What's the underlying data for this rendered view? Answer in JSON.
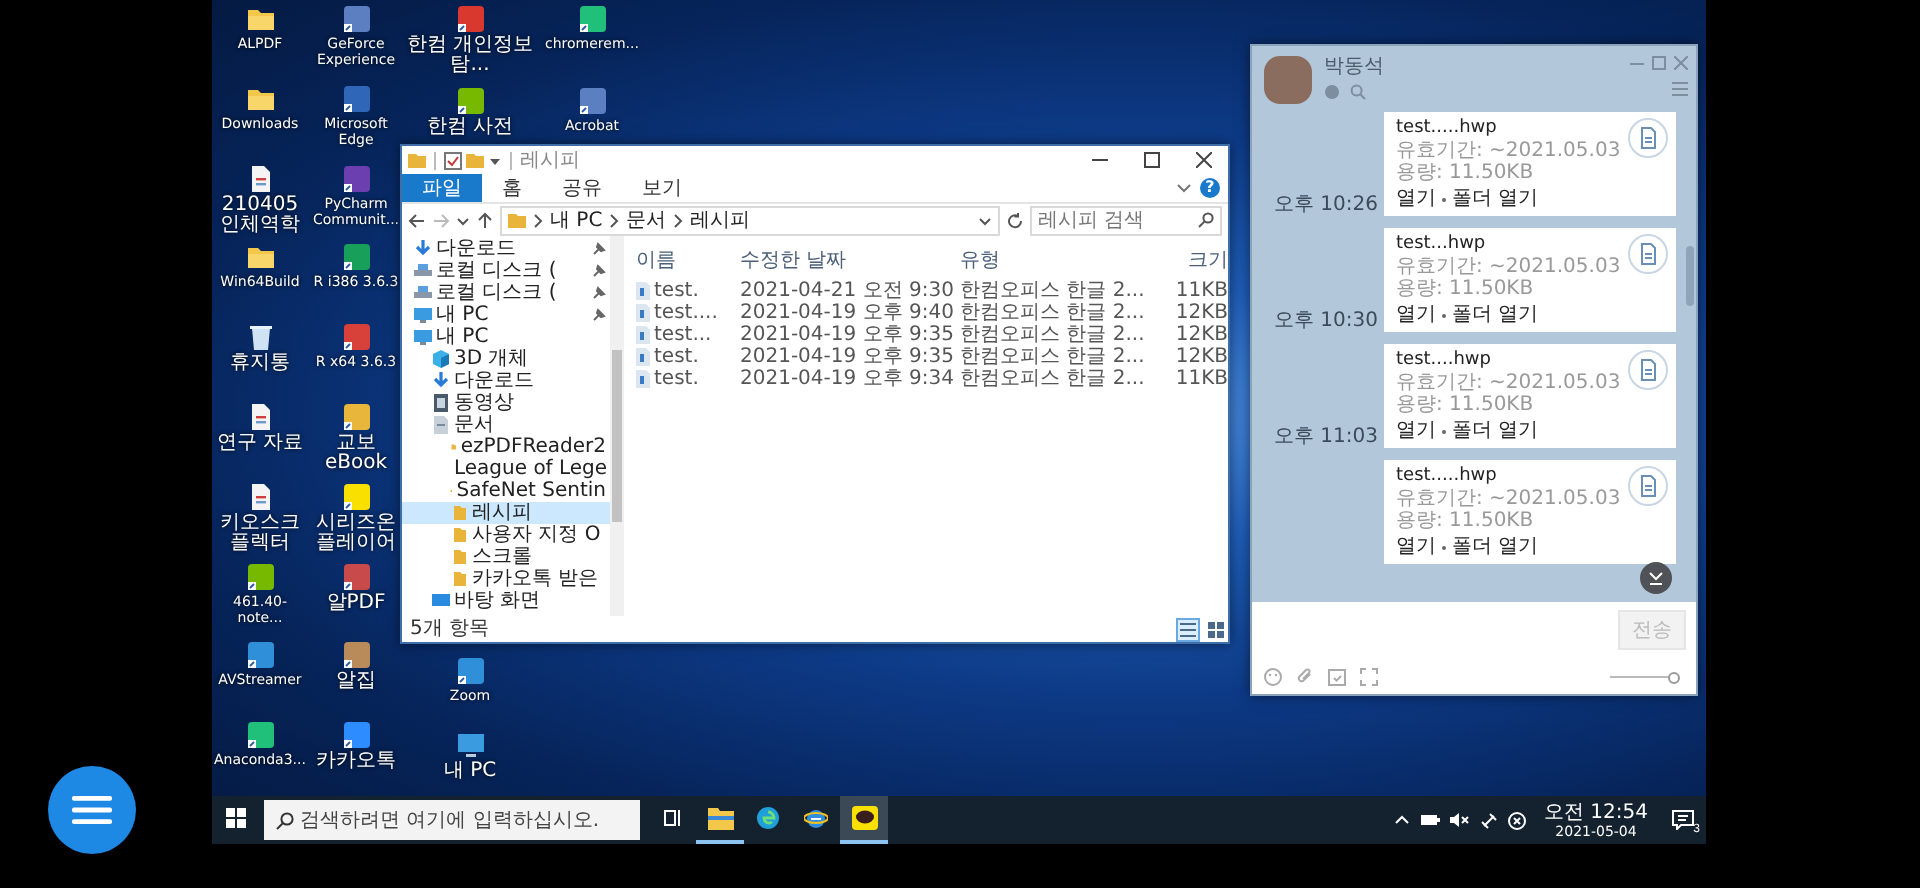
{
  "desktop": {
    "columns": [
      {
        "top": [
          {
            "label": "ALPDF",
            "kind": "folder"
          },
          {
            "label": "Downloads",
            "kind": "folder"
          },
          {
            "label": "210405 인체역학",
            "kind": "file"
          },
          {
            "label": "Win64Build",
            "kind": "folder"
          },
          {
            "label": "휴지통",
            "kind": "recycle"
          },
          {
            "label": "연구 자료",
            "kind": "file"
          },
          {
            "label": "키오스크 플렉터",
            "kind": "file"
          },
          {
            "label": "461.40-note...",
            "kind": "app"
          },
          {
            "label": "AVStreamer",
            "kind": "app"
          },
          {
            "label": "Anaconda3...",
            "kind": "app"
          }
        ]
      },
      {
        "top": [
          {
            "label": "GeForce Experience",
            "kind": "app"
          },
          {
            "label": "Microsoft Edge",
            "kind": "app"
          },
          {
            "label": "PyCharm Communit...",
            "kind": "app"
          },
          {
            "label": "R i386 3.6.3",
            "kind": "app"
          },
          {
            "label": "R x64 3.6.3",
            "kind": "app"
          },
          {
            "label": "교보eBook",
            "kind": "app"
          },
          {
            "label": "시리즈온 플레이어",
            "kind": "app"
          },
          {
            "label": "알PDF",
            "kind": "app"
          },
          {
            "label": "알집",
            "kind": "app"
          },
          {
            "label": "카카오톡",
            "kind": "app"
          }
        ]
      },
      {
        "top": [
          {
            "label": "한컴 개인정보탐...",
            "kind": "app"
          },
          {
            "label": "한컴 사전",
            "kind": "app"
          }
        ],
        "bottom": [
          {
            "label": "Zoom",
            "kind": "app"
          },
          {
            "label": "내 PC",
            "kind": "pc"
          }
        ]
      },
      {
        "top": [
          {
            "label": "chromerem...",
            "kind": "app"
          },
          {
            "label": "Acrobat",
            "kind": "app"
          }
        ]
      }
    ]
  },
  "explorer": {
    "title": "레시피",
    "ribbon_tabs": [
      {
        "label": "파일",
        "selected": true
      },
      {
        "label": "홈",
        "selected": false
      },
      {
        "label": "공유",
        "selected": false
      },
      {
        "label": "보기",
        "selected": false
      }
    ],
    "help": "?",
    "path": [
      "내 PC",
      "문서",
      "레시피"
    ],
    "search": {
      "placeholder": "레시피 검색"
    },
    "nav": [
      {
        "label": "다운로드",
        "kind": "download",
        "pinned": true,
        "selected": false
      },
      {
        "label": "로컬 디스크 (",
        "kind": "drive",
        "pinned": true,
        "selected": false
      },
      {
        "label": "로컬 디스크 (",
        "kind": "drive",
        "pinned": true,
        "selected": false
      },
      {
        "label": "내 PC",
        "kind": "pc",
        "pinned": true,
        "selected": false
      },
      {
        "label": "내 PC",
        "kind": "pc",
        "pinned": false,
        "selected": false,
        "children": [
          {
            "label": "3D 개체",
            "kind": "cube",
            "pinned": false,
            "selected": false
          },
          {
            "label": "다운로드",
            "kind": "download",
            "pinned": false,
            "selected": false
          },
          {
            "label": "동영상",
            "kind": "video",
            "pinned": false,
            "selected": false
          },
          {
            "label": "문서",
            "kind": "document",
            "pinned": false,
            "selected": false,
            "children": [
              {
                "label": "ezPDFReader2",
                "kind": "folder",
                "pinned": false,
                "selected": false
              },
              {
                "label": "League of Lege",
                "kind": "folder",
                "pinned": false,
                "selected": false
              },
              {
                "label": "SafeNet Sentin",
                "kind": "folder",
                "pinned": false,
                "selected": false
              },
              {
                "label": "레시피",
                "kind": "folder",
                "pinned": false,
                "selected": true
              },
              {
                "label": "사용자 지정 O",
                "kind": "folder",
                "pinned": false,
                "selected": false
              },
              {
                "label": "스크롤",
                "kind": "folder",
                "pinned": false,
                "selected": false
              },
              {
                "label": "카카오톡 받은",
                "kind": "folder",
                "pinned": false,
                "selected": false
              }
            ]
          },
          {
            "label": "바탕 화면",
            "kind": "desktop",
            "pinned": false,
            "selected": false
          }
        ]
      }
    ],
    "columns": [
      "이름",
      "수정한 날짜",
      "유형",
      "크기"
    ],
    "rows": [
      {
        "cells": [
          "test.",
          "2021-04-21 오전 9:30",
          "한컴오피스 한글 2...",
          "11KB"
        ],
        "selected": false
      },
      {
        "cells": [
          "test....",
          "2021-04-19 오후 9:40",
          "한컴오피스 한글 2...",
          "12KB"
        ],
        "selected": false
      },
      {
        "cells": [
          "test...",
          "2021-04-19 오후 9:35",
          "한컴오피스 한글 2...",
          "12KB"
        ],
        "selected": false
      },
      {
        "cells": [
          "test.",
          "2021-04-19 오후 9:35",
          "한컴오피스 한글 2...",
          "12KB"
        ],
        "selected": false
      },
      {
        "cells": [
          "test.",
          "2021-04-19 오후 9:34",
          "한컴오피스 한글 2...",
          "11KB"
        ],
        "selected": false
      }
    ],
    "status": "5개 항목",
    "views": [
      {
        "kind": "details",
        "selected": true
      },
      {
        "kind": "tiles",
        "selected": false
      }
    ]
  },
  "chat": {
    "contact": "박동석",
    "messages": [
      {
        "file": "test.....hwp",
        "expiry": "유효기간: ~2021.05.03",
        "size": "용량: 11.50KB",
        "actions": [
          "열기",
          "폴더 열기"
        ],
        "time": "오후 10:26"
      },
      {
        "file": "test...hwp",
        "expiry": "유효기간: ~2021.05.03",
        "size": "용량: 11.50KB",
        "actions": [
          "열기",
          "폴더 열기"
        ],
        "time": "오후 10:30"
      },
      {
        "file": "test....hwp",
        "expiry": "유효기간: ~2021.05.03",
        "size": "용량: 11.50KB",
        "actions": [
          "열기",
          "폴더 열기"
        ],
        "time": "오후 11:03"
      },
      {
        "file": "test.....hwp",
        "expiry": "유효기간: ~2021.05.03",
        "size": "용량: 11.50KB",
        "actions": [
          "열기",
          "폴더 열기"
        ]
      }
    ],
    "send": {
      "label": "전송",
      "disabled": true
    },
    "slider": {
      "level": 0.95
    }
  },
  "taskbar": {
    "search": {
      "placeholder": "검색하려면 여기에 입력하십시오."
    },
    "apps": [
      {
        "kind": "explorer",
        "running": true,
        "active": false
      },
      {
        "kind": "edge",
        "running": false,
        "active": false
      },
      {
        "kind": "ie",
        "running": false,
        "active": false
      },
      {
        "kind": "kakaotalk",
        "running": true,
        "active": true
      }
    ],
    "time": "오전 12:54",
    "date": "2021-05-04",
    "notifications": "3"
  }
}
